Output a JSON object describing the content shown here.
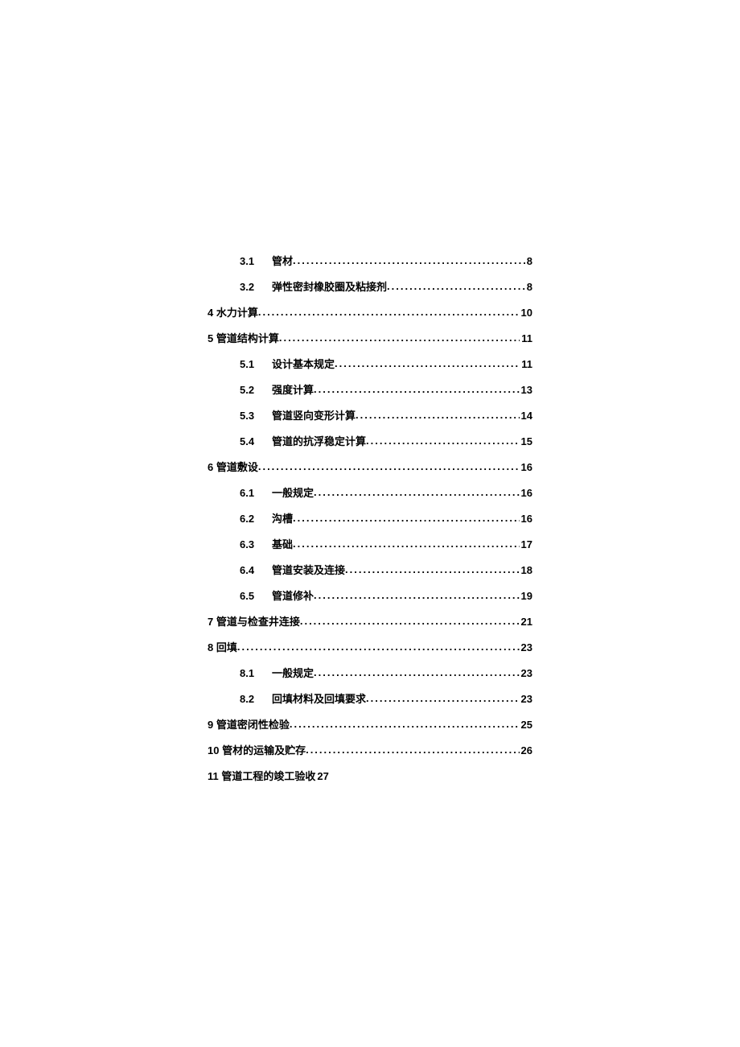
{
  "toc": [
    {
      "level": "sub",
      "num": "3.1",
      "title": "管材",
      "page": "8"
    },
    {
      "level": "sub",
      "num": "3.2",
      "title": "弹性密封橡胶圈及粘接剂",
      "page": "8"
    },
    {
      "level": "top",
      "num": "4",
      "title": "水力计算",
      "page": "10"
    },
    {
      "level": "top",
      "num": "5",
      "title": "管道结构计算",
      "page": "11"
    },
    {
      "level": "sub",
      "num": "5.1",
      "title": "设计基本规定",
      "page": "11"
    },
    {
      "level": "sub",
      "num": "5.2",
      "title": "强度计算",
      "page": "13"
    },
    {
      "level": "sub",
      "num": "5.3",
      "title": "管道竖向变形计算",
      "page": "14"
    },
    {
      "level": "sub",
      "num": "5.4",
      "title": "管道的抗浮稳定计算",
      "page": "15"
    },
    {
      "level": "top",
      "num": "6",
      "title": "管道敷设",
      "page": "16"
    },
    {
      "level": "sub",
      "num": "6.1",
      "title": "一般规定",
      "page": "16"
    },
    {
      "level": "sub",
      "num": "6.2",
      "title": "沟槽",
      "page": "16"
    },
    {
      "level": "sub",
      "num": "6.3",
      "title": "基础",
      "page": "17"
    },
    {
      "level": "sub",
      "num": "6.4",
      "title": "管道安装及连接",
      "page": "18"
    },
    {
      "level": "sub",
      "num": "6.5",
      "title": "管道修补",
      "page": "19"
    },
    {
      "level": "top",
      "num": "7",
      "title": "管道与检查井连接",
      "page": "21"
    },
    {
      "level": "top",
      "num": "8",
      "title": "回填",
      "page": "23"
    },
    {
      "level": "sub",
      "num": "8.1",
      "title": "一般规定",
      "page": "23"
    },
    {
      "level": "sub",
      "num": "8.2",
      "title": "回填材料及回填要求",
      "page": "23"
    },
    {
      "level": "top",
      "num": "9",
      "title": "管道密闭性检验",
      "page": "25"
    },
    {
      "level": "top",
      "num": "10",
      "title": "管材的运输及贮存",
      "page": "26"
    },
    {
      "level": "top",
      "num": "11",
      "title": "管道工程的竣工验收",
      "page": "27",
      "nodots": true
    }
  ]
}
